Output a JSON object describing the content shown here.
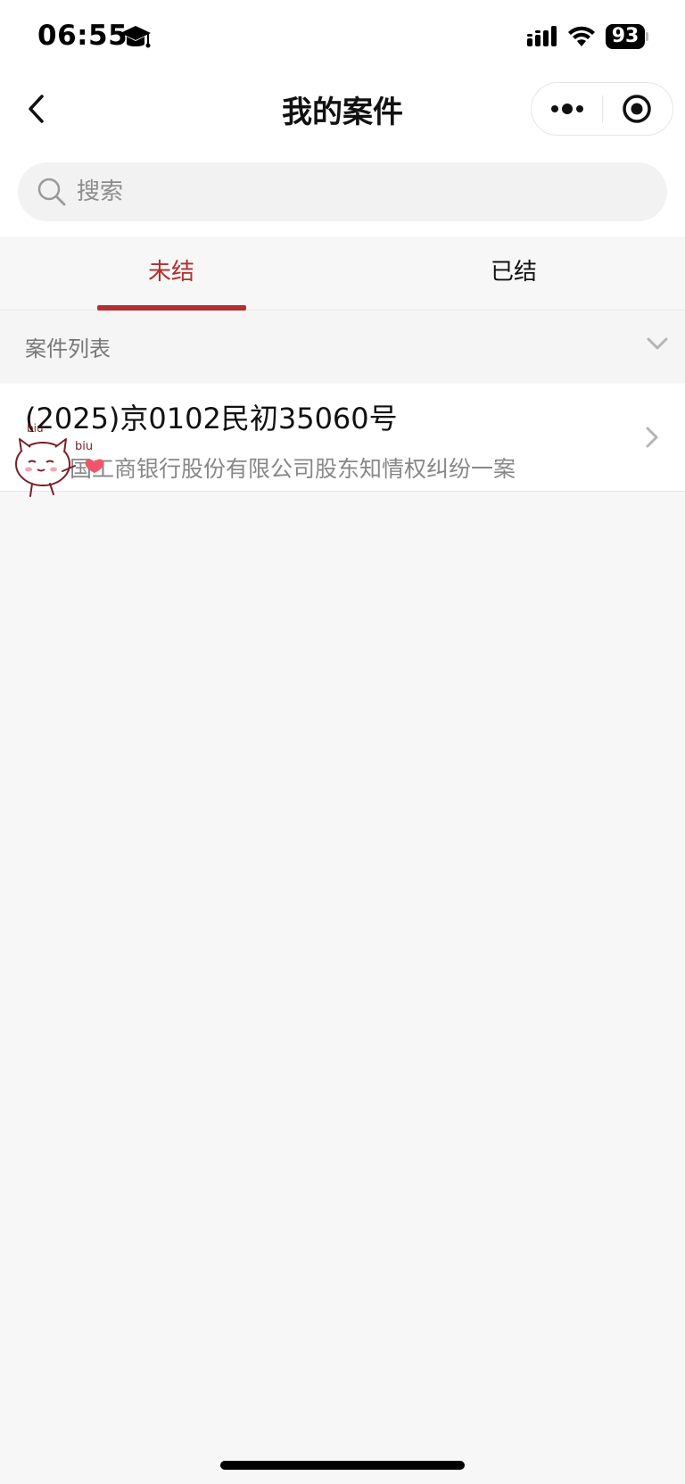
{
  "status_bar": {
    "time": "06:55",
    "battery_level": "93",
    "icons": [
      "graduation-cap-icon",
      "signal-icon",
      "wifi-icon",
      "battery-icon"
    ]
  },
  "nav": {
    "title": "我的案件",
    "back_icon": "chevron-left-icon",
    "more_icon": "more-dots-icon",
    "close_icon": "target-close-icon"
  },
  "search": {
    "placeholder": "搜索",
    "icon": "search-icon"
  },
  "tabs": [
    {
      "label": "未结",
      "active": true
    },
    {
      "label": "已结",
      "active": false
    }
  ],
  "section": {
    "title": "案件列表",
    "icon": "chevron-down-icon"
  },
  "cases": [
    {
      "number": "(2025)京0102民初35060号",
      "description": "与中国工商银行股份有限公司股东知情权纠纷一案"
    }
  ],
  "sticker": {
    "text_1": "biu",
    "text_2": "biu"
  },
  "colors": {
    "accent": "#b22f2f",
    "background": "#f7f7f7",
    "surface": "#ffffff"
  }
}
